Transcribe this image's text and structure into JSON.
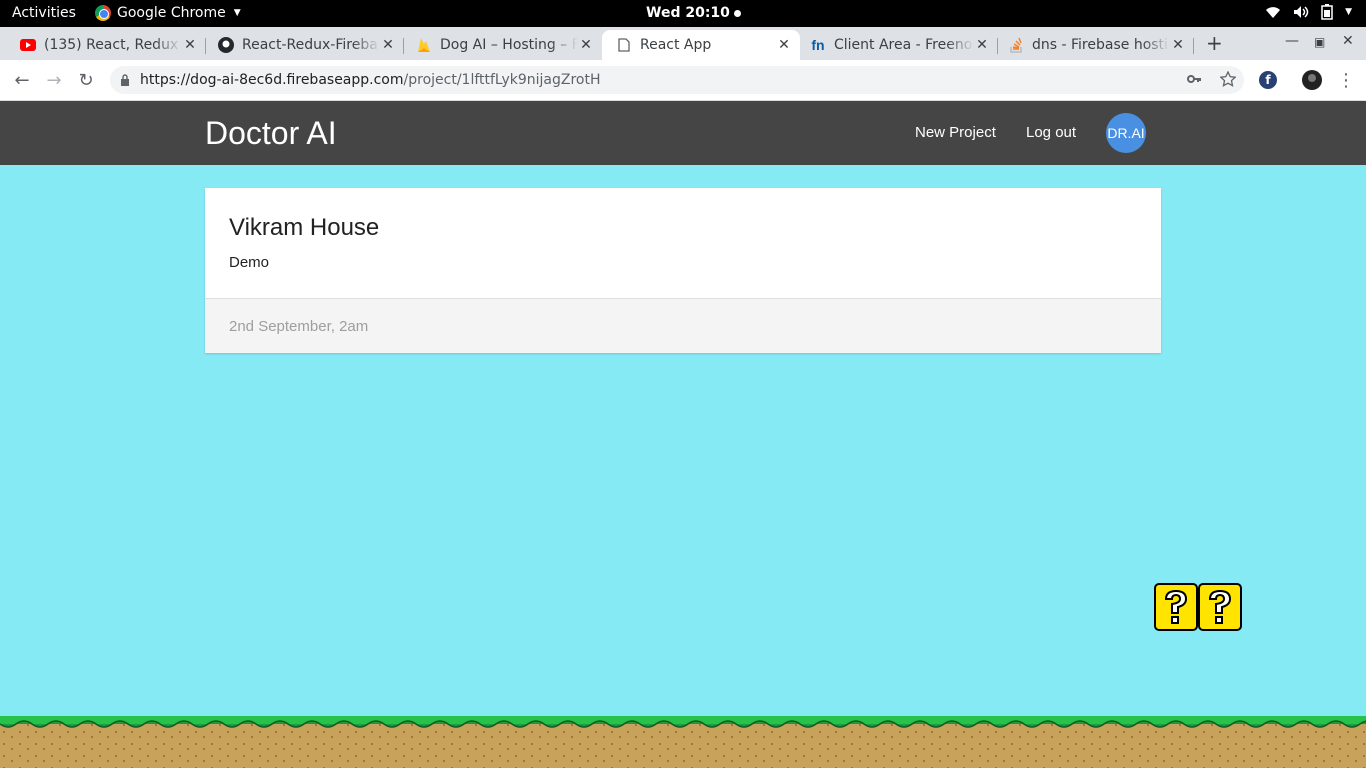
{
  "system_bar": {
    "activities": "Activities",
    "app_name": "Google Chrome",
    "clock": "Wed 20:10"
  },
  "browser": {
    "tabs": [
      {
        "title": "(135) React, Redux & ",
        "icon": "youtube-icon",
        "active": false
      },
      {
        "title": "React-Redux-Fireba",
        "icon": "github-icon",
        "active": false
      },
      {
        "title": "Dog AI – Hosting – F",
        "icon": "firebase-icon",
        "active": false
      },
      {
        "title": "React App",
        "icon": "page-icon",
        "active": true
      },
      {
        "title": "Client Area - Freeno",
        "icon": "freenom-icon",
        "active": false
      },
      {
        "title": "dns - Firebase hosti",
        "icon": "stackoverflow-icon",
        "active": false
      }
    ],
    "url_host": "https://dog-ai-8ec6d.firebaseapp.com",
    "url_path": "/project/1lfttfLyk9nijagZrotH"
  },
  "navbar": {
    "brand": "Doctor AI",
    "new_project": "New Project",
    "logout": "Log out",
    "avatar": "DR.AI",
    "avatar_color": "#4A90E2"
  },
  "project": {
    "title": "Vikram House",
    "content": "Demo",
    "created": "2nd September, 2am"
  },
  "colors": {
    "sky": "#85EAF4",
    "navbar": "#454545",
    "grass": "#27C24C",
    "dirt": "#C8A15B"
  }
}
